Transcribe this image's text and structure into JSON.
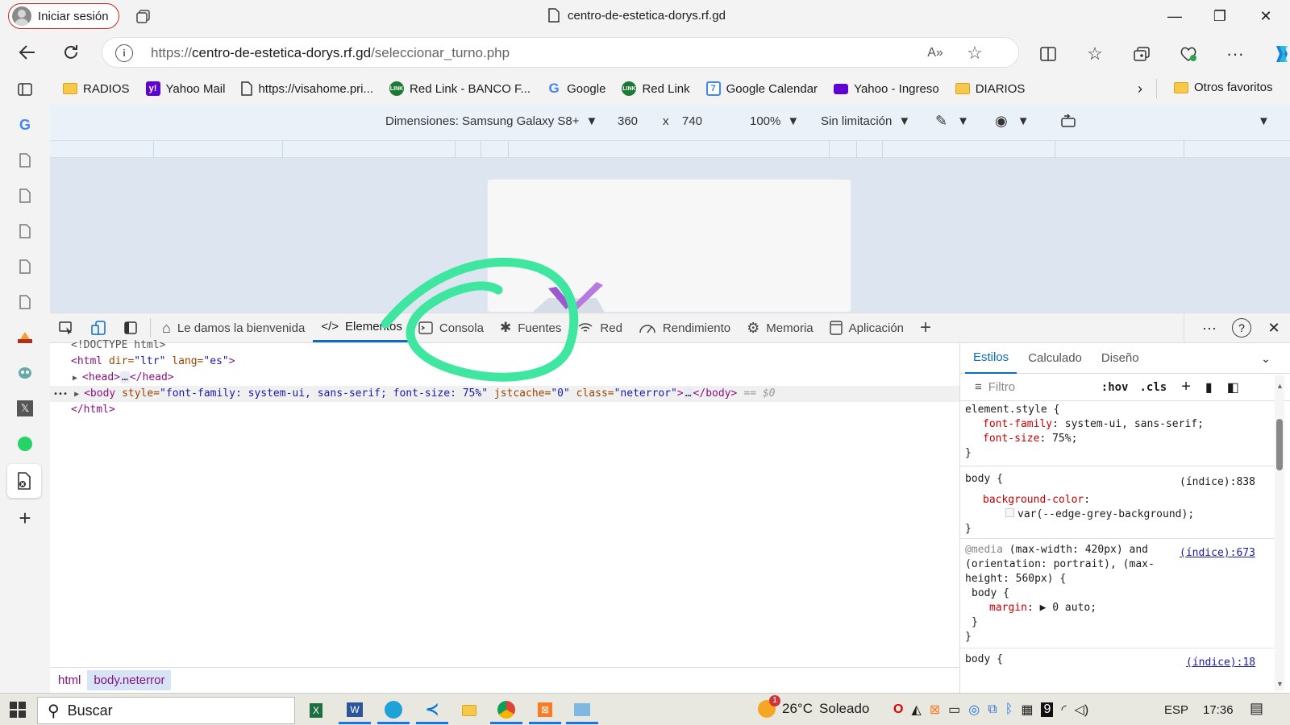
{
  "titlebar": {
    "signin_label": "Iniciar sesión",
    "tab_title": "centro-de-estetica-dorys.rf.gd",
    "minimize": "—",
    "restore": "❐",
    "close": "✕"
  },
  "address": {
    "url_prefix": "https://",
    "url_host": "centro-de-estetica-dorys.rf.gd",
    "url_path": "/seleccionar_turno.php"
  },
  "favorites": [
    {
      "label": "RADIOS",
      "icon": "folder-icon"
    },
    {
      "label": "Yahoo Mail",
      "icon": "yahoo-icon"
    },
    {
      "label": "https://visahome.pri...",
      "icon": "page-icon"
    },
    {
      "label": "Red Link - BANCO F...",
      "icon": "redlink-icon"
    },
    {
      "label": "Google",
      "icon": "google-icon"
    },
    {
      "label": "Red Link",
      "icon": "redlink-icon"
    },
    {
      "label": "Google Calendar",
      "icon": "calendar-icon"
    },
    {
      "label": "Yahoo - Ingreso",
      "icon": "mail-icon"
    },
    {
      "label": "DIARIOS",
      "icon": "folder-icon"
    }
  ],
  "favorites_other": "Otros favoritos",
  "device_toolbar": {
    "dimensions_label": "Dimensiones: Samsung Galaxy S8+",
    "width": "360",
    "times": "x",
    "height": "740",
    "zoom": "100%",
    "throttle": "Sin limitación"
  },
  "devtools_tabs": [
    {
      "label": "Le damos la bienvenida",
      "icon": "home-icon"
    },
    {
      "label": "Elementos",
      "icon": "code-icon",
      "active": true
    },
    {
      "label": "Consola",
      "icon": "console-icon"
    },
    {
      "label": "Fuentes",
      "icon": "bug-icon"
    },
    {
      "label": "Red",
      "icon": "wifi-icon"
    },
    {
      "label": "Rendimiento",
      "icon": "gauge-icon"
    },
    {
      "label": "Memoria",
      "icon": "chip-icon"
    },
    {
      "label": "Aplicación",
      "icon": "app-icon"
    }
  ],
  "dom": {
    "doctype": "<!DOCTYPE html>",
    "html_open_tag": "<html",
    "html_dir_attr": " dir=",
    "html_dir_val": "\"ltr\"",
    "html_lang_attr": " lang=",
    "html_lang_val": "\"es\"",
    "html_open_close": ">",
    "head_open": "<head>",
    "head_close": "</head>",
    "ellipsis": "…",
    "body_open_tag": "<body",
    "body_style_attr": " style=",
    "body_style_val": "\"font-family: system-ui, sans-serif; font-size: 75%\"",
    "body_jst_attr": " jstcache=",
    "body_jst_val": "\"0\"",
    "body_class_attr": " class=",
    "body_class_val": "\"neterror\"",
    "body_open_close": ">",
    "body_close": "</body>",
    "selected_marker": "== $0",
    "row_dots": "•••",
    "html_close": "</html>"
  },
  "breadcrumbs": [
    "html",
    "body.neterror"
  ],
  "styles_tabs": [
    "Estilos",
    "Calculado",
    "Diseño"
  ],
  "filter_placeholder": "Filtro",
  "hov": ":hov",
  "cls": ".cls",
  "style_rules": {
    "r1_selector": "element.style {",
    "r1_p1_name": "font-family",
    "r1_p1_val": ": system-ui, sans-serif;",
    "r1_p2_name": "font-size",
    "r1_p2_val": ": 75%;",
    "close": "}",
    "r2_selector": "body {",
    "r2_link": "(índice):838",
    "r2_p1_name": "background-color",
    "r2_p1_colon": ":",
    "r2_p1_val": "var(--edge-grey-background);",
    "r3_media_kw": "@media",
    "r3_media_line1": " (max-width: 420px) and",
    "r3_media_line2": "(orientation: portrait), (max-",
    "r3_media_line3": "height: 560px) {",
    "r3_link": "(índice):673",
    "r3_selector": "body {",
    "r3_p1_name": "margin",
    "r3_p1_val": ": ▶ 0 auto;",
    "r4_selector": "body {",
    "r4_link": "(índice):18"
  },
  "taskbar": {
    "search_label": "Buscar",
    "weather_badge": "1",
    "weather_temp": "26°C",
    "weather_cond": "Soleado",
    "lang": "ESP",
    "time": "17:36"
  },
  "colors": {
    "accent": "#0f6cbd",
    "annotation": "#3ee6a0"
  }
}
